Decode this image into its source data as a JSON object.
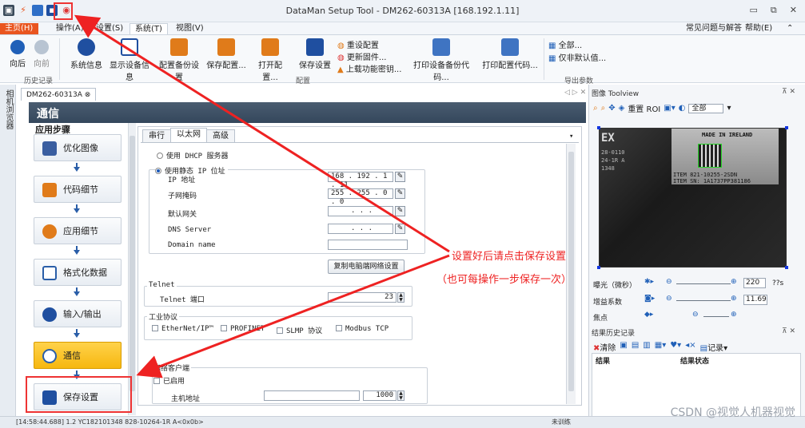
{
  "titlebar": {
    "title": "DataMan Setup Tool - DM262-60313A [168.192.1.11]",
    "minimize": "▭",
    "restore": "⧉",
    "close": "✕"
  },
  "menu": {
    "home": "主页(H)",
    "operate": "操作(A)",
    "settings": "设置(S)",
    "system": "系统(T)",
    "view": "视图(V)",
    "faq": "常见问题与解答",
    "help": "帮助(E)",
    "collapse": "⌃"
  },
  "ribbon": {
    "back": "向后",
    "forward": "向前",
    "history_group": "历史记录",
    "sysinfo": "系统信息",
    "show_device": "显示设备信息",
    "config_backup": "配置备份设置",
    "save_config": "保存配置...",
    "open_config": "打开配置...",
    "save_settings": "保存设置",
    "reset_config": "重设配置",
    "update_fw": "更新固件...",
    "upload_key": "上载功能密钥...",
    "print_backup": "打印设备备份代码...",
    "print_config": "打印配置代码...",
    "config_group": "配置",
    "all": "全部...",
    "only_default": "仅非默认值...",
    "export_group": "导出参数"
  },
  "left_strip": {
    "label": "相机浏览器"
  },
  "doc_tab": {
    "label": "DM262-60313A",
    "nav": "◁ ▷ ✕"
  },
  "header": {
    "title": "通信"
  },
  "steps": {
    "title": "应用步骤",
    "items": [
      "优化图像",
      "代码细节",
      "应用细节",
      "格式化数据",
      "输入/输出",
      "通信",
      "保存设置"
    ]
  },
  "tabs": [
    "串行",
    "以太网",
    "高级"
  ],
  "network": {
    "dhcp": "使用 DHCP 服务器",
    "static": "使用静态 IP 位址",
    "ip_label": "IP 地址",
    "ip_value": "168 . 192 . 1 . 11",
    "mask_label": "子网掩码",
    "mask_value": "255 . 255 . 0 . 0",
    "gateway_label": "默认网关",
    "gateway_value": ". . .",
    "dns_label": "DNS Server",
    "dns_value": ". . .",
    "domain_label": "Domain name",
    "domain_value": "",
    "copy_button": "复制电脑端网络设置"
  },
  "telnet": {
    "section": "Telnet",
    "port_label": "Telnet 端口",
    "port_value": "23"
  },
  "industrial": {
    "section": "工业协议",
    "items": [
      "EtherNet/IP™",
      "PROFINET",
      "SLMP 协议",
      "Modbus TCP"
    ]
  },
  "client": {
    "section": "网络客户端",
    "enabled": "已启用",
    "host_label": "主机地址",
    "host_value": "",
    "port_value": "1000"
  },
  "annotation": {
    "line1": "设置好后请点击保存设置",
    "line2": "（也可每操作一步保存一次）"
  },
  "image_panel": {
    "title": "图像 Toolview",
    "reset_roi": "重置 ROI",
    "all": "全部",
    "made_in": "MADE IN IRELAND",
    "item1": "ITEM 821-10255-2SDN",
    "item2": "ITEM SN: 1A1737PP381186",
    "side1": "28-0110",
    "side2": "24-1R A",
    "side3": "1348",
    "ex": "EX"
  },
  "controls": {
    "exposure_label": "曝光（微秒）",
    "exposure_value": "220",
    "exposure_unit": "??s",
    "gain_label": "增益系数",
    "gain_value": "11.69",
    "focus_label": "焦点"
  },
  "history": {
    "title": "结果历史记录",
    "clear": "清除",
    "record": "记录",
    "col_result": "结果",
    "col_status": "结果状态"
  },
  "status": {
    "text": "[14:58:44.688] 1.2 YC182101348 828-10264-1R A<0x0b>",
    "right": "未训练"
  },
  "watermark": "CSDN @视觉人机器视觉",
  "colors": {
    "accent": "#e9551f",
    "annotation": "#e22222",
    "active_step": "#f6b70f",
    "header": "#3b4e63"
  }
}
